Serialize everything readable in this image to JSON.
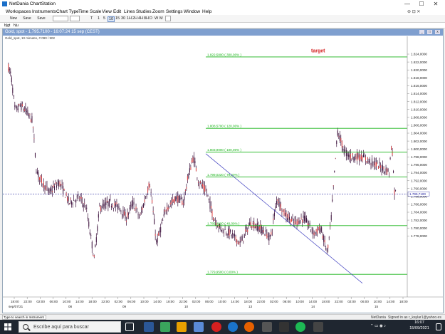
{
  "window": {
    "title": "NetDania ChartStation",
    "minimize": "—",
    "maximize": "☐",
    "close": "✕"
  },
  "menu": {
    "items": [
      "Workspaces",
      "Instruments",
      "Chart Type",
      "Time Scale",
      "View",
      "Edit",
      "Lines",
      "Studies",
      "Zoom",
      "Settings",
      "Window",
      "Help"
    ],
    "right_icons": "⊖ ⊡ ✕"
  },
  "toolbar": {
    "new_label": "New",
    "save_label": "Save",
    "saveas_label": "Save as",
    "timeframes": [
      "T",
      "1",
      "5",
      "10",
      "15",
      "30",
      "1H",
      "2H",
      "4H",
      "8H",
      "D",
      "W",
      "M"
    ],
    "selected_timeframe": "10"
  },
  "subbar": {
    "left": "b|gt",
    "right": "h|u"
  },
  "chart": {
    "window_title": "Gold, spot - 1,795.7100 - 16:07:24  15 sep (CEST)",
    "subtitle": "Gold_spot, 10 minutes, # 090 / 902",
    "target_label": "target",
    "current_price_label": "1.795,7100",
    "fib_levels": [
      {
        "label": "1.822,5800 ( 300,00% )",
        "value": 1822.58
      },
      {
        "label": "1.808,5700 ( 120,00% )",
        "value": 1808.57
      },
      {
        "label": "1.803,9000 ( 100,00% )",
        "value": 1803.9
      },
      {
        "label": "1.799,0220 ( 79,20% )",
        "value": 1799.02
      },
      {
        "label": "1.789,4900 ( 40,00% )",
        "value": 1789.49
      },
      {
        "label": "1.779,9500 ( 0,00% )",
        "value": 1779.95
      }
    ],
    "y_ticks": [
      "1.824,0000",
      "1.822,0000",
      "1.820,0000",
      "1.818,0000",
      "1.816,0000",
      "1.814,0000",
      "1.812,0000",
      "1.810,0000",
      "1.808,0000",
      "1.806,0000",
      "1.804,0000",
      "1.802,0000",
      "1.800,0000",
      "1.798,0000",
      "1.796,0000",
      "1.794,0000",
      "1.792,0000",
      "1.790,0000",
      "1.788,0000",
      "1.786,0000",
      "1.784,0000",
      "1.782,0000",
      "1.780,0000",
      "1.778,0000"
    ],
    "x_ticks": [
      "18:00",
      "22:00",
      "02:00",
      "06:00",
      "10:00",
      "14:00",
      "18:00",
      "22:00",
      "02:00",
      "06:00",
      "10:00",
      "14:00",
      "18:00",
      "22:00",
      "02:00",
      "06:00",
      "10:00",
      "14:00",
      "18:00",
      "22:00",
      "02:00",
      "06:00",
      "10:00",
      "14:00",
      "18:00",
      "22:00",
      "02:00",
      "06:00",
      "10:00",
      "14:00",
      "18:00"
    ],
    "x_dates": [
      {
        "label": "sep/07/21"
      },
      {
        "label": "08"
      },
      {
        "label": "09"
      },
      {
        "label": "10"
      },
      {
        "label": "13"
      },
      {
        "label": "14"
      },
      {
        "label": "15"
      }
    ],
    "colors": {
      "fib": "#19b319",
      "fib_text": "#19b319",
      "target": "#d42020",
      "candles": "#3a0f3a",
      "trendline": "#4040c0",
      "current_line": "#2020a0"
    }
  },
  "statusbar": {
    "search_placeholder": "Type to search in Instrument",
    "brand": "NetDania",
    "signed_in": "Signed in as r_kaylar1@yahoo.es"
  },
  "taskbar": {
    "search_text": "Escribe aquí para buscar",
    "time": "16:07",
    "date": "15/09/2021"
  }
}
